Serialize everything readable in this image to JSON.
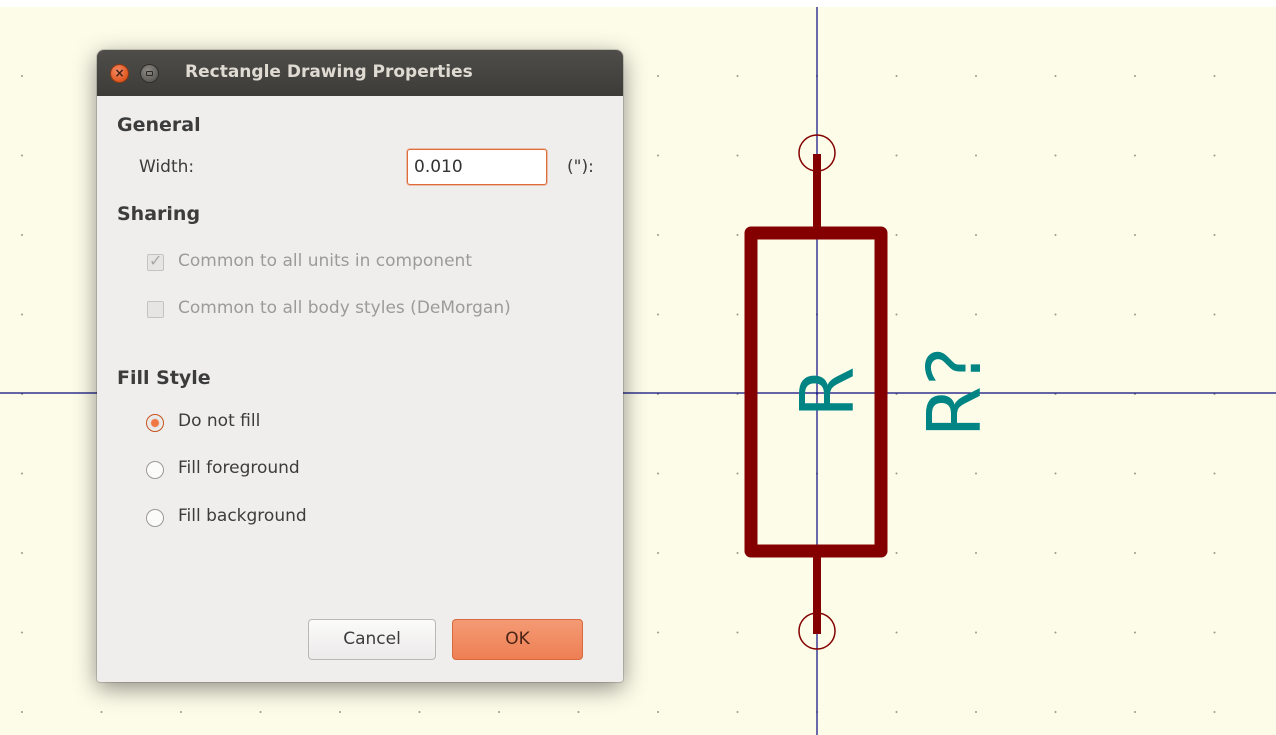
{
  "canvas": {
    "background_color": "#fdfce9",
    "grid_dot_color": "#9a9a8a",
    "axis_color": "#0a0a80",
    "symbol_color": "#840000",
    "text_color": "#008484",
    "reference_text": "R?",
    "value_text": "R"
  },
  "dialog": {
    "title": "Rectangle Drawing Properties",
    "close_icon": "close-icon",
    "minimize_icon": "minimize-icon",
    "general": {
      "heading": "General",
      "width_label": "Width:",
      "width_value": "0.010",
      "width_unit": "(\"):"
    },
    "sharing": {
      "heading": "Sharing",
      "common_units_label": "Common to all units in component",
      "common_units_checked": true,
      "common_units_enabled": false,
      "common_body_label": "Common to all body styles (DeMorgan)",
      "common_body_checked": false,
      "common_body_enabled": false
    },
    "fill": {
      "heading": "Fill Style",
      "options": [
        "Do not fill",
        "Fill foreground",
        "Fill background"
      ],
      "selected": "Do not fill"
    },
    "buttons": {
      "cancel": "Cancel",
      "ok": "OK"
    },
    "accent_color": "#ee7f54"
  }
}
